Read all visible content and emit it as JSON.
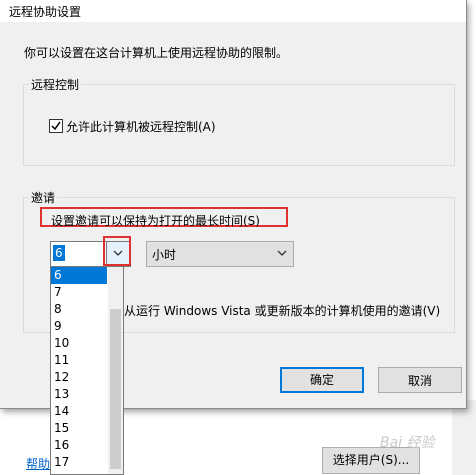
{
  "dialog": {
    "title": "远程协助设置",
    "description": "你可以设置在这台计算机上使用远程协助的限制。"
  },
  "remote_control": {
    "group_label": "远程控制",
    "checkbox_label": "允许此计算机被远程控制(A)",
    "checked": true
  },
  "invitation": {
    "group_label": "邀请",
    "max_time_label": "设置邀请可以保持为打开的最长时间(S)",
    "duration_value": "6",
    "unit_value": "小时",
    "vista_label": "从运行 Windows Vista 或更新版本的计算机使用的邀请(V)",
    "dropdown_options": [
      "6",
      "7",
      "8",
      "9",
      "10",
      "11",
      "12",
      "13",
      "14",
      "15",
      "16",
      "17"
    ]
  },
  "buttons": {
    "ok": "确定",
    "cancel": "取消"
  },
  "background": {
    "help_link": "帮助",
    "select_users": "选择用户(S)..."
  },
  "watermark": "Bai 经验",
  "colors": {
    "highlight_red": "#e03131",
    "selection_blue": "#0078d7"
  }
}
